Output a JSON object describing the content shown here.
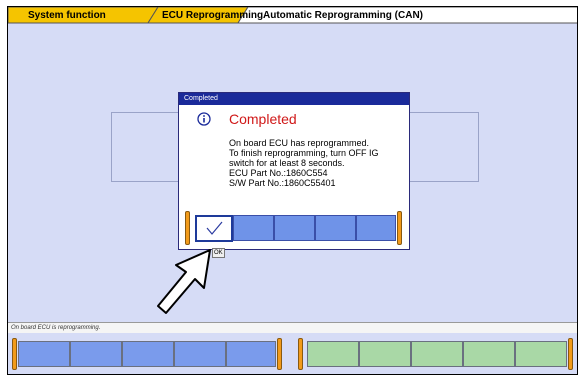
{
  "breadcrumb": {
    "tab1": "System function",
    "tab2": "ECU Reprogramming",
    "tab3": "Automatic Reprogramming (CAN)"
  },
  "dialog": {
    "window_title": "Completed",
    "heading": "Completed",
    "message_lines": [
      "On board ECU has reprogrammed.",
      "To finish reprogramming, turn OFF IG",
      "switch for at least 8 seconds.",
      "ECU Part No.:1860C554",
      "S/W Part No.:1860C55401"
    ],
    "ok_tooltip": "OK"
  },
  "status_bar": {
    "text": "On board ECU is reprogramming."
  },
  "colors": {
    "background": "#d6dcf6",
    "title_bar": "#1a2a9a",
    "heading_red": "#d01818",
    "key_blue": "#7a9bec",
    "key_green": "#a9d8a6",
    "cap_orange": "#f29b1a",
    "tab_yellow": "#f5c400"
  },
  "icons": {
    "info": "info-icon",
    "check": "checkmark-icon",
    "pointer": "arrow-pointer-icon"
  }
}
